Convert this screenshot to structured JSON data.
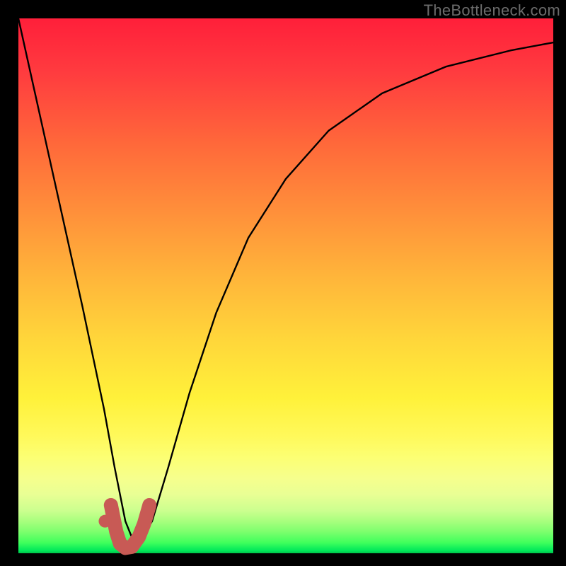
{
  "watermark": "TheBottleneck.com",
  "colors": {
    "frame_bg": "#000000",
    "curve_color": "#000000",
    "marker_color": "#c85a55",
    "gradient_top": "#ff1f3a",
    "gradient_bottom": "#00c04a"
  },
  "chart_data": {
    "type": "line",
    "title": "",
    "xlabel": "",
    "ylabel": "",
    "xlim": [
      0,
      1
    ],
    "ylim": [
      0,
      1
    ],
    "note": "No axis ticks or labels visible; values below are visual-fraction estimates in [0,1] plot coordinates.",
    "series": [
      {
        "name": "main-curve",
        "x": [
          0.0,
          0.04,
          0.08,
          0.12,
          0.16,
          0.18,
          0.2,
          0.22,
          0.25,
          0.28,
          0.32,
          0.37,
          0.43,
          0.5,
          0.58,
          0.68,
          0.8,
          0.92,
          1.0
        ],
        "y": [
          1.0,
          0.82,
          0.64,
          0.46,
          0.27,
          0.16,
          0.06,
          0.01,
          0.06,
          0.16,
          0.3,
          0.45,
          0.59,
          0.7,
          0.79,
          0.86,
          0.91,
          0.94,
          0.955
        ]
      }
    ],
    "marker": {
      "name": "hook-marker",
      "color": "#c85a55",
      "points_xy": [
        [
          0.173,
          0.09
        ],
        [
          0.183,
          0.04
        ],
        [
          0.19,
          0.018
        ],
        [
          0.2,
          0.01
        ],
        [
          0.212,
          0.012
        ],
        [
          0.225,
          0.03
        ],
        [
          0.235,
          0.055
        ],
        [
          0.245,
          0.09
        ]
      ],
      "dot_xy": [
        0.162,
        0.06
      ]
    }
  }
}
